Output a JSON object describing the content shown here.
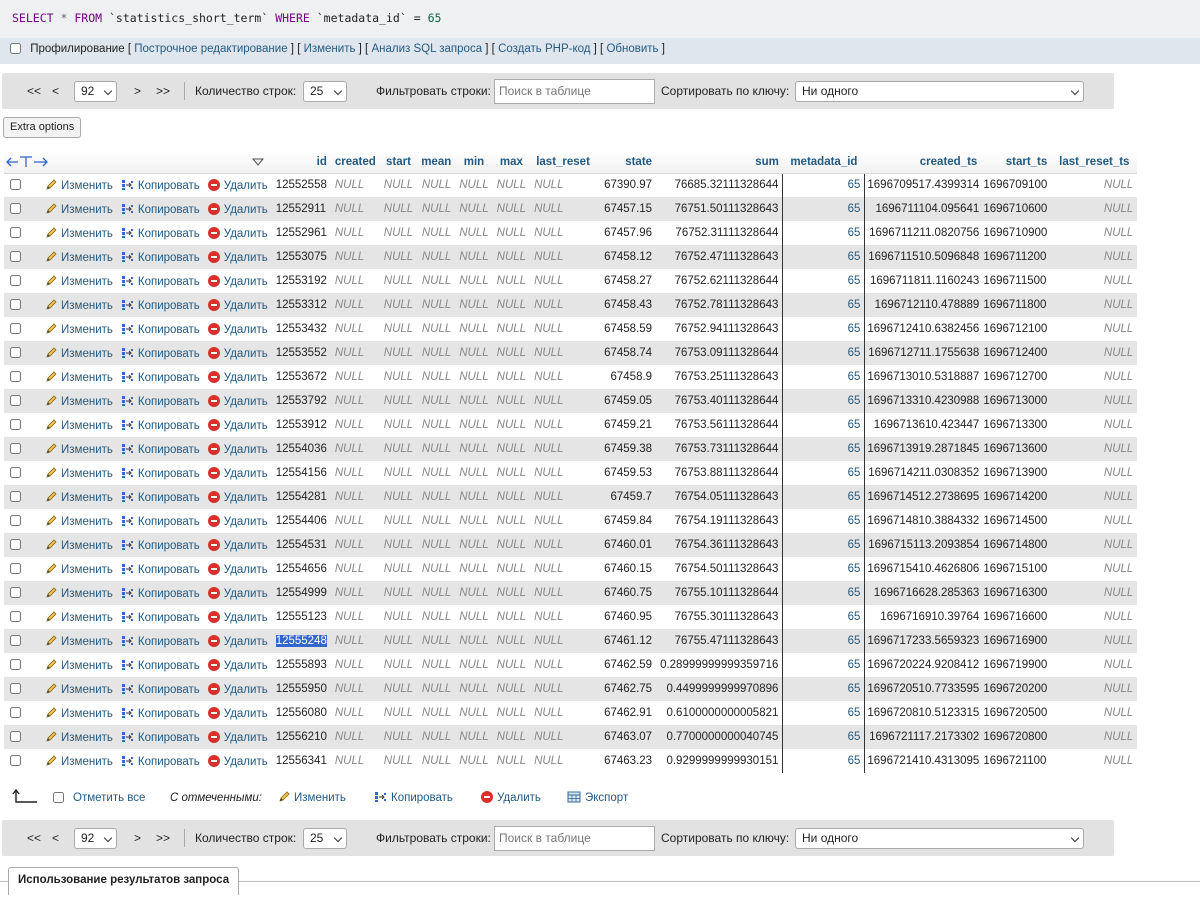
{
  "sql": {
    "select": "SELECT",
    "star": "*",
    "from": "FROM",
    "table": "`statistics_short_term`",
    "where": "WHERE",
    "column": "`metadata_id`",
    "eq": "=",
    "value": "65"
  },
  "profiling": {
    "label": "Профилирование",
    "links": [
      "Построчное редактирование",
      "Изменить",
      "Анализ SQL запроса",
      "Создать PHP-код",
      "Обновить"
    ]
  },
  "nav": {
    "first": "<<",
    "prev": "<",
    "page": "92",
    "next": ">",
    "last": ">>",
    "rows_label": "Количество строк:",
    "rows_value": "25",
    "filter_label": "Фильтровать строки:",
    "filter_placeholder": "Поиск в таблице",
    "sort_label": "Сортировать по ключу:",
    "sort_value": "Ни одного"
  },
  "extra_options": "Extra options",
  "columns": [
    "id",
    "created",
    "start",
    "mean",
    "min",
    "max",
    "last_reset",
    "state",
    "sum",
    "metadata_id",
    "created_ts",
    "start_ts",
    "last_reset_ts"
  ],
  "actions": {
    "edit": "Изменить",
    "copy": "Копировать",
    "delete": "Удалить"
  },
  "null_text": "NULL",
  "rows": [
    {
      "id": "12552558",
      "state": "67390.97",
      "sum": "76685.32111328644",
      "metadata_id": "65",
      "created_ts": "1696709517.4399314",
      "start_ts": "1696709100"
    },
    {
      "id": "12552911",
      "state": "67457.15",
      "sum": "76751.50111328643",
      "metadata_id": "65",
      "created_ts": "1696711104.095641",
      "start_ts": "1696710600"
    },
    {
      "id": "12552961",
      "state": "67457.96",
      "sum": "76752.31111328644",
      "metadata_id": "65",
      "created_ts": "1696711211.0820756",
      "start_ts": "1696710900"
    },
    {
      "id": "12553075",
      "state": "67458.12",
      "sum": "76752.47111328643",
      "metadata_id": "65",
      "created_ts": "1696711510.5096848",
      "start_ts": "1696711200"
    },
    {
      "id": "12553192",
      "state": "67458.27",
      "sum": "76752.62111328644",
      "metadata_id": "65",
      "created_ts": "1696711811.1160243",
      "start_ts": "1696711500"
    },
    {
      "id": "12553312",
      "state": "67458.43",
      "sum": "76752.78111328643",
      "metadata_id": "65",
      "created_ts": "1696712110.478889",
      "start_ts": "1696711800"
    },
    {
      "id": "12553432",
      "state": "67458.59",
      "sum": "76752.94111328643",
      "metadata_id": "65",
      "created_ts": "1696712410.6382456",
      "start_ts": "1696712100"
    },
    {
      "id": "12553552",
      "state": "67458.74",
      "sum": "76753.09111328644",
      "metadata_id": "65",
      "created_ts": "1696712711.1755638",
      "start_ts": "1696712400"
    },
    {
      "id": "12553672",
      "state": "67458.9",
      "sum": "76753.25111328643",
      "metadata_id": "65",
      "created_ts": "1696713010.5318887",
      "start_ts": "1696712700"
    },
    {
      "id": "12553792",
      "state": "67459.05",
      "sum": "76753.40111328644",
      "metadata_id": "65",
      "created_ts": "1696713310.4230988",
      "start_ts": "1696713000"
    },
    {
      "id": "12553912",
      "state": "67459.21",
      "sum": "76753.56111328644",
      "metadata_id": "65",
      "created_ts": "1696713610.423447",
      "start_ts": "1696713300"
    },
    {
      "id": "12554036",
      "state": "67459.38",
      "sum": "76753.73111328644",
      "metadata_id": "65",
      "created_ts": "1696713919.2871845",
      "start_ts": "1696713600"
    },
    {
      "id": "12554156",
      "state": "67459.53",
      "sum": "76753.88111328644",
      "metadata_id": "65",
      "created_ts": "1696714211.0308352",
      "start_ts": "1696713900"
    },
    {
      "id": "12554281",
      "state": "67459.7",
      "sum": "76754.05111328643",
      "metadata_id": "65",
      "created_ts": "1696714512.2738695",
      "start_ts": "1696714200"
    },
    {
      "id": "12554406",
      "state": "67459.84",
      "sum": "76754.19111328643",
      "metadata_id": "65",
      "created_ts": "1696714810.3884332",
      "start_ts": "1696714500"
    },
    {
      "id": "12554531",
      "state": "67460.01",
      "sum": "76754.36111328643",
      "metadata_id": "65",
      "created_ts": "1696715113.2093854",
      "start_ts": "1696714800"
    },
    {
      "id": "12554656",
      "state": "67460.15",
      "sum": "76754.50111328643",
      "metadata_id": "65",
      "created_ts": "1696715410.4626806",
      "start_ts": "1696715100"
    },
    {
      "id": "12554999",
      "state": "67460.75",
      "sum": "76755.10111328644",
      "metadata_id": "65",
      "created_ts": "1696716628.285363",
      "start_ts": "1696716300"
    },
    {
      "id": "12555123",
      "state": "67460.95",
      "sum": "76755.30111328643",
      "metadata_id": "65",
      "created_ts": "1696716910.39764",
      "start_ts": "1696716600"
    },
    {
      "id": "12555248",
      "state": "67461.12",
      "sum": "76755.47111328643",
      "metadata_id": "65",
      "created_ts": "1696717233.5659323",
      "start_ts": "1696716900"
    },
    {
      "id": "12555893",
      "state": "67462.59",
      "sum": "0.28999999999359716",
      "metadata_id": "65",
      "created_ts": "1696720224.9208412",
      "start_ts": "1696719900"
    },
    {
      "id": "12555950",
      "state": "67462.75",
      "sum": "0.4499999999970896",
      "metadata_id": "65",
      "created_ts": "1696720510.7733595",
      "start_ts": "1696720200"
    },
    {
      "id": "12556080",
      "state": "67462.91",
      "sum": "0.6100000000005821",
      "metadata_id": "65",
      "created_ts": "1696720810.5123315",
      "start_ts": "1696720500"
    },
    {
      "id": "12556210",
      "state": "67463.07",
      "sum": "0.7700000000040745",
      "metadata_id": "65",
      "created_ts": "1696721117.2173302",
      "start_ts": "1696720800"
    },
    {
      "id": "12556341",
      "state": "67463.23",
      "sum": "0.9299999999930151",
      "metadata_id": "65",
      "created_ts": "1696721410.4313095",
      "start_ts": "1696721100"
    }
  ],
  "selected_id": "12555248",
  "footer": {
    "check_all": "Отметить все",
    "with_selected": "С отмеченными:",
    "edit": "Изменить",
    "copy": "Копировать",
    "delete": "Удалить",
    "export": "Экспорт"
  },
  "usage": "Использование результатов запроса"
}
